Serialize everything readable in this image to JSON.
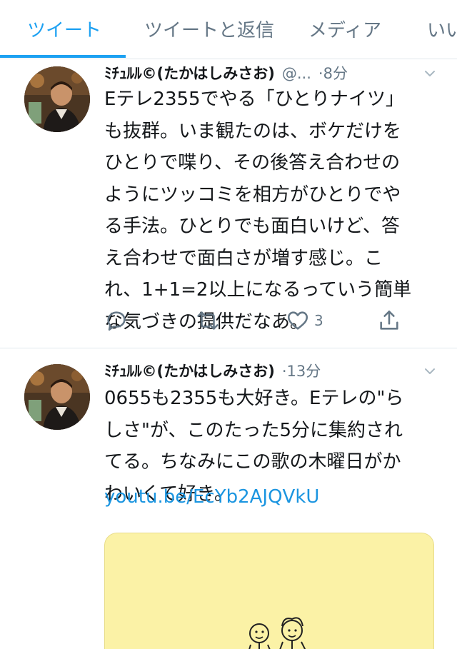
{
  "tabs": [
    {
      "label": "ツイート",
      "active": true
    },
    {
      "label": "ツイートと返信",
      "active": false
    },
    {
      "label": "メディア",
      "active": false
    },
    {
      "label": "いいね",
      "active": false
    }
  ],
  "tweets": [
    {
      "name": "ﾐﾁｭﾙﾙ©(たかはしみさお)",
      "handle": "@...",
      "time": "8分",
      "text": "Eテレ2355でやる「ひとりナイツ」\nも抜群。いま観たのは、ボケだけを\nひとりで喋り、その後答え合わせの\nようにツッコミを相方がひとりでや\nる手法。ひとりでも面白いけど、答\nえ合わせで面白さが増す感じ。こ\nれ、1+1=2以上になるっていう簡単\nな気づきの提供だなあ。",
      "like_count": "3"
    },
    {
      "name": "ﾐﾁｭﾙﾙ©(たかはしみさお)",
      "time": "13分",
      "text": "0655も2355も大好き。Eテレの\"ら\nしさ\"が、このたった5分に集約され\nてる。ちなみにこの歌の木曜日がか\nわいくて好き。",
      "link": "youtu.be/EcYb2AJQVkU"
    }
  ],
  "colors": {
    "accent": "#1da1f2",
    "link": "#1b95e0",
    "secondary_text": "#657786",
    "card_background": "#fbf2a6"
  },
  "icons": [
    "reply-icon",
    "retweet-icon",
    "like-icon",
    "share-icon",
    "chevron-down-icon"
  ]
}
